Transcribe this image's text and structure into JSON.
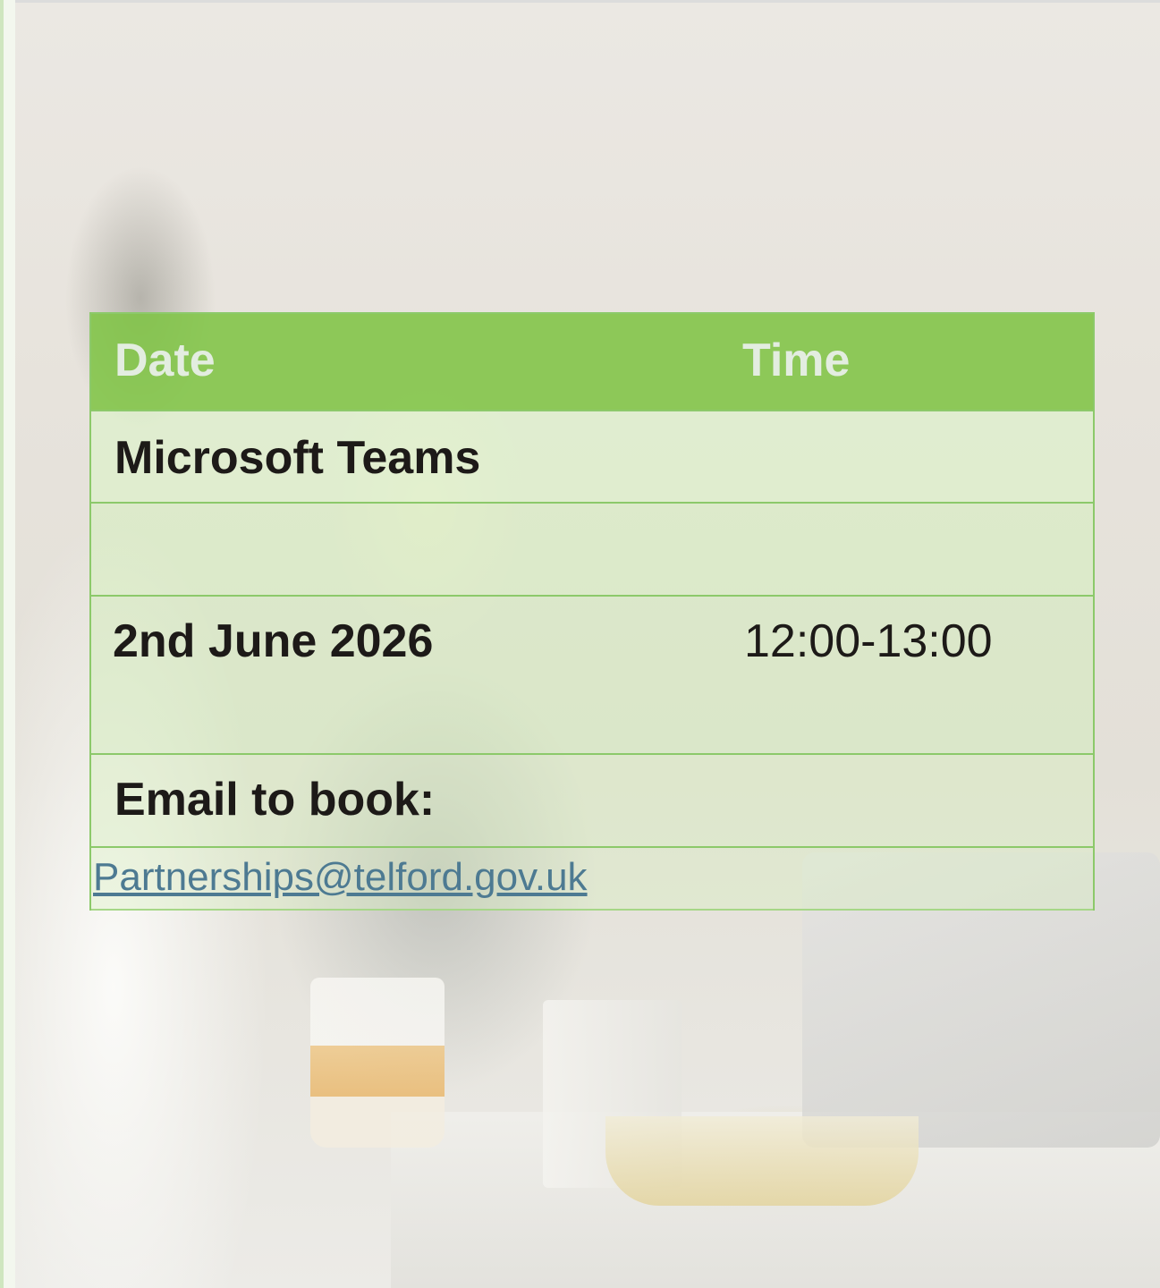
{
  "table": {
    "header": {
      "date": "Date",
      "time": "Time"
    },
    "platform": "Microsoft Teams",
    "session": {
      "date": "2nd June 2026",
      "time": "12:00-13:00"
    },
    "email_label": "Email to book:",
    "email_link": "Partnerships@telford.gov.uk"
  }
}
